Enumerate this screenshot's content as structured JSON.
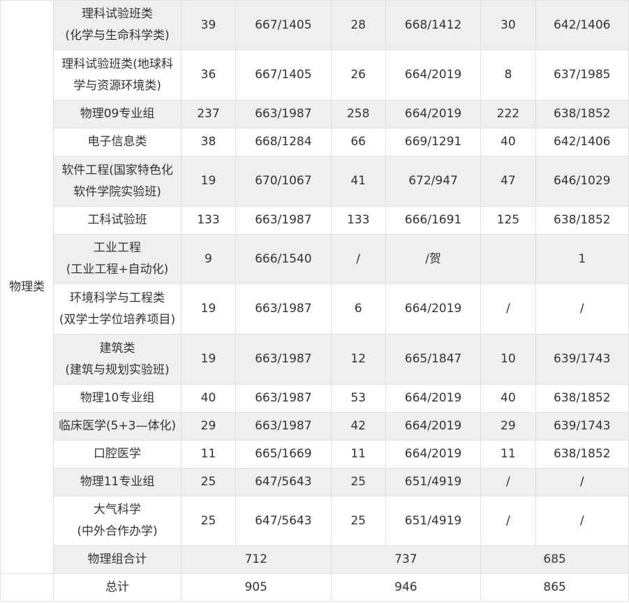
{
  "category": "物理类",
  "rows": [
    {
      "name": [
        "理科试验班类",
        "(化学与生命科学类)"
      ],
      "v": [
        "39",
        "667/1405",
        "28",
        "668/1412",
        "30",
        "642/1406"
      ]
    },
    {
      "name": [
        "理科试验班类(地球科",
        "学与资源环境类)"
      ],
      "v": [
        "36",
        "667/1405",
        "26",
        "664/2019",
        "8",
        "637/1985"
      ]
    },
    {
      "name": [
        "物理09专业组"
      ],
      "v": [
        "237",
        "663/1987",
        "258",
        "664/2019",
        "222",
        "638/1852"
      ]
    },
    {
      "name": [
        "电子信息类"
      ],
      "v": [
        "38",
        "668/1284",
        "66",
        "669/1291",
        "40",
        "642/1406"
      ]
    },
    {
      "name": [
        "软件工程(国家特色化",
        "软件学院实验班)"
      ],
      "v": [
        "19",
        "670/1067",
        "41",
        "672/947",
        "47",
        "646/1029"
      ]
    },
    {
      "name": [
        "工科试验班"
      ],
      "v": [
        "133",
        "663/1987",
        "133",
        "666/1691",
        "125",
        "638/1852"
      ]
    },
    {
      "name": [
        "工业工程",
        "(工业工程+自动化)"
      ],
      "v": [
        "9",
        "666/1540",
        "/",
        "/贺",
        "",
        "1"
      ]
    },
    {
      "name": [
        "环境科学与工程类",
        "(双学士学位培养项目)"
      ],
      "v": [
        "19",
        "663/1987",
        "6",
        "664/2019",
        "/",
        "/"
      ]
    },
    {
      "name": [
        "建筑类",
        "(建筑与规划实验班)"
      ],
      "v": [
        "19",
        "663/1987",
        "12",
        "665/1847",
        "10",
        "639/1743"
      ]
    },
    {
      "name": [
        "物理10专业组"
      ],
      "v": [
        "40",
        "663/1987",
        "53",
        "664/2019",
        "40",
        "638/1852"
      ]
    },
    {
      "name": [
        "临床医学(5+3—体化)"
      ],
      "v": [
        "29",
        "663/1987",
        "42",
        "664/2019",
        "29",
        "639/1743"
      ]
    },
    {
      "name": [
        "口腔医学"
      ],
      "v": [
        "11",
        "665/1669",
        "11",
        "664/2019",
        "11",
        "638/1852"
      ]
    },
    {
      "name": [
        "物理11专业组"
      ],
      "v": [
        "25",
        "647/5643",
        "25",
        "651/4919",
        "/",
        "/"
      ]
    },
    {
      "name": [
        "大气科学",
        "(中外合作办学)"
      ],
      "v": [
        "25",
        "647/5643",
        "25",
        "651/4919",
        "/",
        "/"
      ]
    }
  ],
  "subtotal": {
    "label": "物理组合计",
    "v": [
      "712",
      "737",
      "685"
    ]
  },
  "total": {
    "label": "总计",
    "v": [
      "905",
      "946",
      "865"
    ]
  }
}
